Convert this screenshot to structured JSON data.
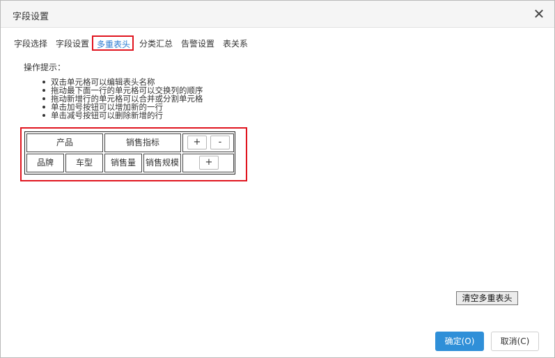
{
  "dialog": {
    "title": "字段设置"
  },
  "tabs": [
    {
      "label": "字段选择"
    },
    {
      "label": "字段设置"
    },
    {
      "label": "多重表头",
      "active": true
    },
    {
      "label": "分类汇总"
    },
    {
      "label": "告警设置"
    },
    {
      "label": "表关系"
    }
  ],
  "hints": {
    "title": "操作提示：",
    "items": [
      "双击单元格可以编辑表头名称",
      "拖动最下面一行的单元格可以交换列的顺序",
      "拖动新增行的单元格可以合并或分割单元格",
      "单击加号按钮可以增加新的一行",
      "单击减号按钮可以删除新增的行"
    ]
  },
  "header_grid": {
    "row1": {
      "cells": [
        "产品",
        "销售指标"
      ],
      "add_label": "+",
      "remove_label": "-"
    },
    "row2": {
      "cells": [
        "品牌",
        "车型",
        "销售量",
        "销售规模"
      ],
      "add_label": "+"
    }
  },
  "buttons": {
    "clear": "清空多重表头",
    "ok": "确定(O)",
    "cancel": "取消(C)"
  },
  "colors": {
    "accent": "#2f8fd8",
    "highlight": "#e0141e",
    "active_tab_text": "#2b7bd1"
  },
  "icons": {
    "close": "close-icon"
  }
}
